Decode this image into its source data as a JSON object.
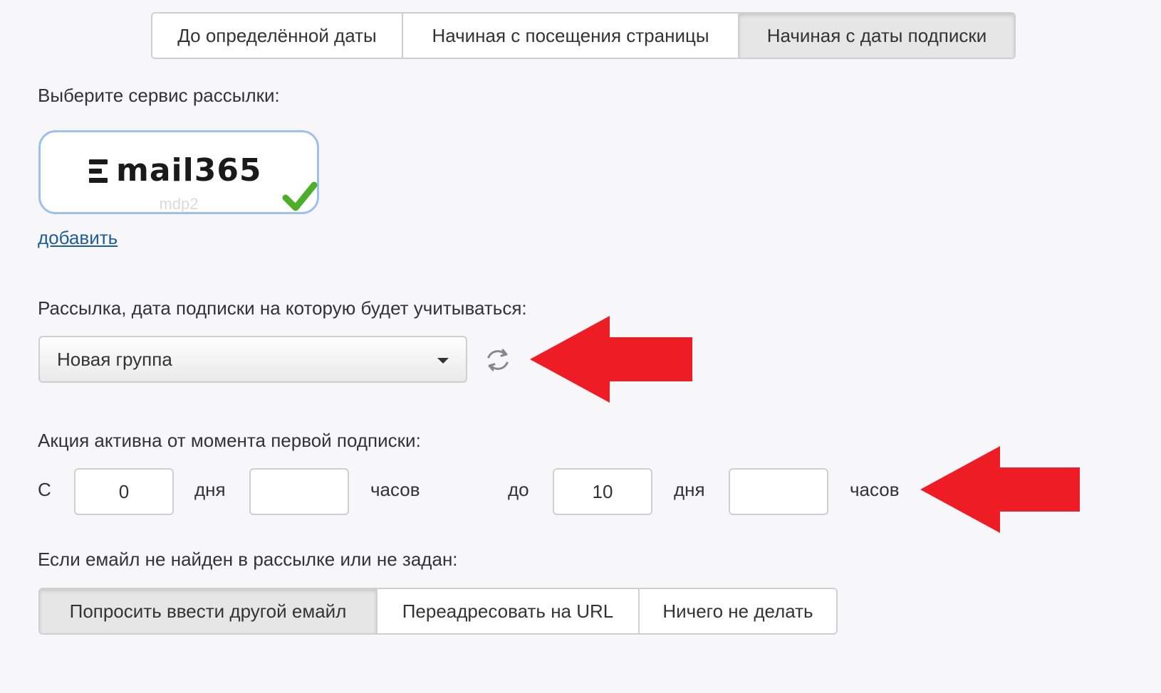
{
  "mode_tabs": {
    "options": [
      "До определённой даты",
      "Начиная с посещения страницы",
      "Начиная с даты подписки"
    ],
    "active_index": 2
  },
  "service": {
    "label": "Выберите сервис рассылки:",
    "name": "mail365",
    "account": "mdp2",
    "selected": true,
    "add_link": "добавить"
  },
  "mailing": {
    "label": "Рассылка, дата подписки на которую будет учитываться:",
    "selected": "Новая группа"
  },
  "period": {
    "label": "Акция активна от момента первой подписки:",
    "from_label": "С",
    "from_days": "0",
    "from_hours": "",
    "days_unit": "дня",
    "hours_unit": "часов",
    "to_label": "до",
    "to_days": "10",
    "to_hours": ""
  },
  "not_found": {
    "label": "Если емайл не найден в рассылке или не задан:",
    "options": [
      "Попросить ввести другой емайл",
      "Переадресовать на URL",
      "Ничего не делать"
    ],
    "active_index": 0
  },
  "colors": {
    "accent_arrow": "#ee1c25",
    "link": "#1f5c9a",
    "check": "#4caf2a",
    "selected_border": "#9fc0ef"
  },
  "icons": [
    "refresh-icon",
    "chevron-down-icon",
    "checkmark-icon",
    "red-arrow-icon"
  ]
}
